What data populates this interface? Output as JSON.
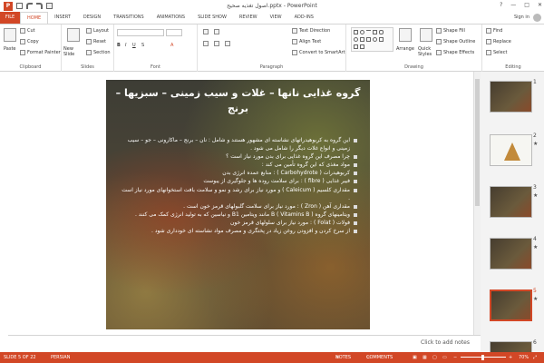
{
  "window": {
    "title": "اصول تغذیه صحیح.pptx - PowerPoint",
    "controls": [
      "?",
      "—",
      "□",
      "✕"
    ]
  },
  "tabs": {
    "file": "FILE",
    "items": [
      "HOME",
      "INSERT",
      "DESIGN",
      "TRANSITIONS",
      "ANIMATIONS",
      "SLIDE SHOW",
      "REVIEW",
      "VIEW",
      "ADD-INS"
    ],
    "active": "HOME",
    "signin": "Sign in"
  },
  "ribbon": {
    "clipboard": {
      "paste": "Paste",
      "cut": "Cut",
      "copy": "Copy",
      "format_painter": "Format Painter",
      "label": "Clipboard"
    },
    "slides": {
      "new_slide": "New Slide",
      "layout": "Layout",
      "reset": "Reset",
      "section": "Section",
      "label": "Slides"
    },
    "font": {
      "label": "Font"
    },
    "paragraph": {
      "text_direction": "Text Direction",
      "align_text": "Align Text",
      "convert_smartart": "Convert to SmartArt",
      "label": "Paragraph"
    },
    "drawing": {
      "arrange": "Arrange",
      "quick_styles": "Quick Styles",
      "shape_fill": "Shape Fill",
      "shape_outline": "Shape Outline",
      "shape_effects": "Shape Effects",
      "label": "Drawing"
    },
    "editing": {
      "find": "Find",
      "replace": "Replace",
      "select": "Select",
      "label": "Editing"
    }
  },
  "slide": {
    "title": "گروه غذایی نانها – غلات و سیب زمینی – سبزیها – برنج",
    "bullets": [
      "این گروه به کربوهیدراتهای نشاسته ای مشهور هستند و شامل : نان – برنج – ماکارونی – جو – سیب زمینی و انواع غلات دیگر را شامل می شود .",
      "چرا مصرف این گروه غذایی برای بدن مورد نیاز است ؟",
      "مواد مغذی که این گروه تأمین می کند :",
      "کربوهیدرات ( Carbohydrote ) : منابع عمده انرژی بدن",
      "فیبر غذایی ( fibre ) : برای سلامت روده ها و جلوگیری از یبوست",
      "مقداری کلسیم ( Caleicum ) و مورد نیاز برای رشد و نمو و سلامت بافت استخوانهای مورد نیاز است .",
      "مقداری آهن ( Zron ) : مورد نیاز برای سلامت گلبولهای قرمز خون است .",
      "ویتامینهای گروه B ( Vitamins B ) مانند ویتامین B1 و نیاسین که به تولید انرژی کمک می کنند .",
      "فولات ( Folat ) : مورد نیاز برای سلولهای قرمز خون",
      "از سرخ کردن و افزودن روغن زیاد در پختگری و مصرف مواد نشاسته ای خودداری شود ."
    ]
  },
  "notes_placeholder": "Click to add notes",
  "thumbnails": [
    {
      "num": "1",
      "star": ""
    },
    {
      "num": "2",
      "star": "★"
    },
    {
      "num": "3",
      "star": "★"
    },
    {
      "num": "4",
      "star": "★"
    },
    {
      "num": "5",
      "star": "★"
    },
    {
      "num": "6",
      "star": ""
    }
  ],
  "status": {
    "slide_info": "SLIDE 5 OF 22",
    "language": "PERSIAN",
    "notes": "NOTES",
    "comments": "COMMENTS",
    "zoom": "70%"
  },
  "colors": {
    "accent": "#d24726"
  }
}
